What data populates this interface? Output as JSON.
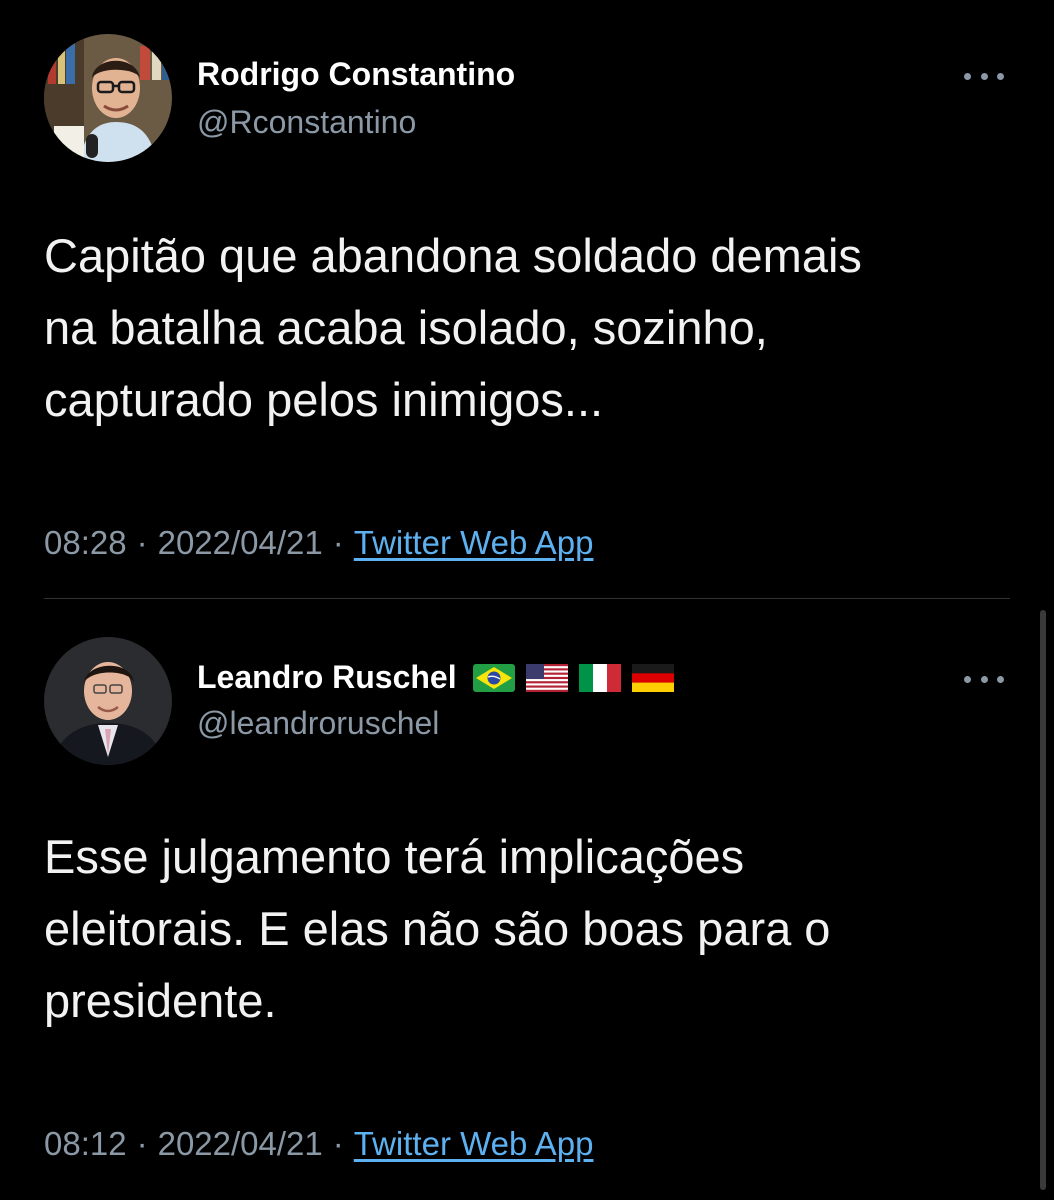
{
  "tweets": [
    {
      "author": {
        "display_name": "Rodrigo Constantino",
        "handle": "@Rconstantino",
        "avatar": "avatar-photo-man-with-glasses-microphone"
      },
      "text": "Capitão que abandona soldado demais\nna batalha acaba isolado, sozinho,\ncapturado pelos inimigos...",
      "time": "08:28",
      "date": "2022/04/21",
      "source": "Twitter Web App",
      "more_icon": "more-horizontal-icon"
    },
    {
      "author": {
        "display_name": "Leandro Ruschel",
        "handle": "@leandroruschel",
        "avatar": "avatar-photo-man-in-suit",
        "flags": [
          "brazil-flag",
          "usa-flag",
          "italy-flag",
          "germany-flag"
        ]
      },
      "text": "Esse julgamento terá implicações\neleitorais. E elas não são boas para o\npresidente.",
      "time": "08:12",
      "date": "2022/04/21",
      "source": "Twitter Web App",
      "more_icon": "more-horizontal-icon"
    }
  ],
  "meta_separator": "·",
  "colors": {
    "background": "#000000",
    "primary_text": "#ffffff",
    "secondary_text": "#8b98a5",
    "link": "#5eb1f0",
    "divider": "#2f3336"
  }
}
